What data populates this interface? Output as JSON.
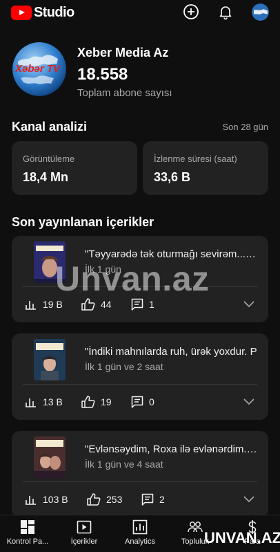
{
  "app": {
    "logo_text": "Studio",
    "brand_color": "#ff0000"
  },
  "topbar_icons": [
    "create-icon",
    "bell-icon",
    "account-avatar"
  ],
  "channel": {
    "name": "Xeber Media Az",
    "subscribers": "18.558",
    "subscribers_label": "Toplam abone sayısı",
    "avatar_text": "Xəbər TV"
  },
  "analytics": {
    "title": "Kanal analizi",
    "period": "Son 28 gün",
    "views_label": "Görüntüleme",
    "views_value": "18,4 Mn",
    "watch_label": "İzlenme süresi (saat)",
    "watch_value": "33,6 B"
  },
  "recent": {
    "title": "Son yayınlanan içerikler",
    "videos": [
      {
        "title": "\"Təyyarədə tək oturmağı sevirəm...\" Əli Əlizadə",
        "age": "İlk 1 gün",
        "views": "19 B",
        "likes": "44",
        "comments": "1"
      },
      {
        "title": "\"İndiki mahnılarda ruh, ürək yoxdur. P",
        "age": "İlk 1 gün ve 2 saat",
        "views": "13 B",
        "likes": "19",
        "comments": "0"
      },
      {
        "title": "\"Evlənsəydim, Roxa ilə evlənərdim. O",
        "age": "İlk 1 gün ve 4 saat",
        "views": "103 B",
        "likes": "253",
        "comments": "2"
      }
    ]
  },
  "nav": [
    "Kontrol Pa...",
    "İçerikler",
    "Analytics",
    "Topluluk",
    "Para"
  ],
  "watermarks": {
    "center": "Unvan.az",
    "corner": "UNVAN.AZ"
  }
}
